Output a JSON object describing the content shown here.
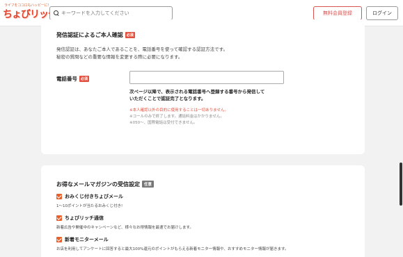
{
  "header": {
    "logo_tagline": "ライフをココロもハッピーに!",
    "logo_brand": "ちょびリッチ。",
    "search_placeholder": "キーワードを入力してください",
    "register_label": "無料会員登録",
    "login_label": "ログイン"
  },
  "verify": {
    "title": "発信認証によるご本人確認",
    "required_badge": "必須",
    "desc_line1": "発信認証は、あなたご本人であることを、電話番号を使って確認する認証方法です。",
    "desc_line2": "秘密の質問などの重要な情報を変更する際に必要になります。",
    "phone_label": "電話番号",
    "phone_required_badge": "必須",
    "phone_value": "",
    "instruction_line1": "次ページ以降で、表示される電話番号へ登録する番号から発信して",
    "instruction_line2": "いただくことで認証完了となります。",
    "note_red": "※本人確認以外の目的に使用することは一切ありません。",
    "note_grey1": "※コールのみで終了します。通話料金はかかりません。",
    "note_grey2": "※050〜、国際電話は受付できません。"
  },
  "newsletter": {
    "title": "お得なメールマガジンの受信設定",
    "optional_badge": "任意",
    "items": [
      {
        "label": "おみくじ付きちょびメール",
        "checked": true,
        "desc": "1〜10ポイントが当たるおみくじ付き!"
      },
      {
        "label": "ちょびリッチ通信",
        "checked": true,
        "desc": "新着広告や開催中のキャンペーンなど、様々なお得情報を最速でお届けします。"
      },
      {
        "label": "新着モニターメール",
        "checked": true,
        "desc": "お店を利用してアンケートに回答すると最大100%還元のポイントがもらえる新着モニター情報や、おすすめモニター情報が届きます。"
      }
    ]
  },
  "colors": {
    "accent": "#e8612c",
    "brand_red": "#e2452f",
    "required_red": "#e0523f"
  }
}
